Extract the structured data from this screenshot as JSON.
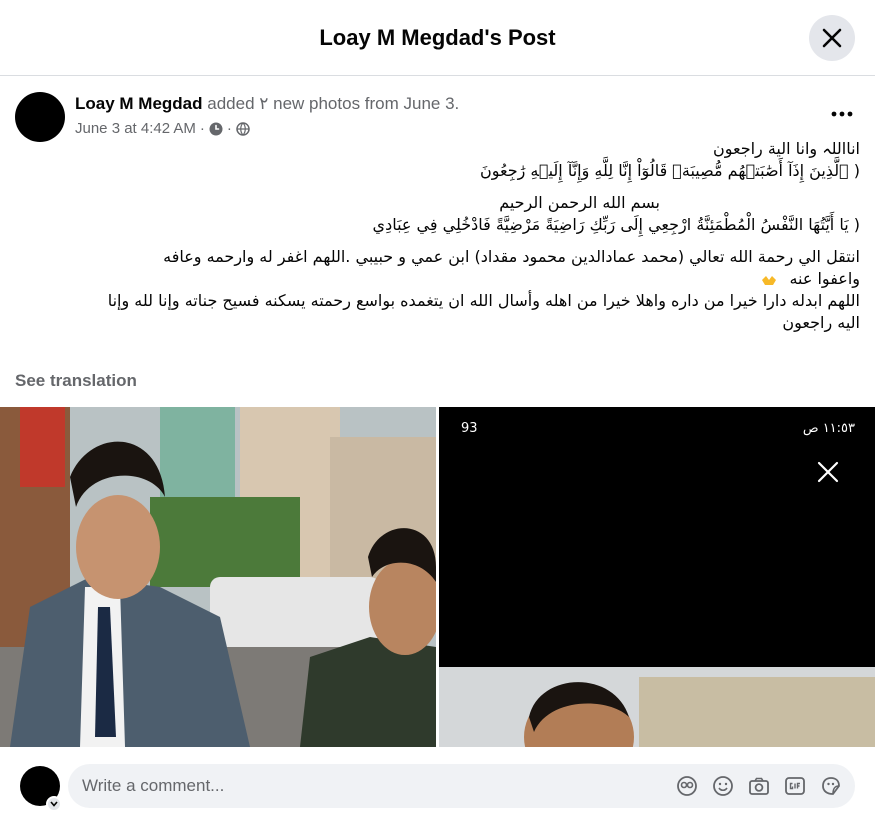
{
  "dialog": {
    "title": "Loay M Megdad's Post"
  },
  "post": {
    "author": "Loay M Megdad",
    "action": "added ٢ new photos from June 3.",
    "timestamp": "June 3 at 4:42 AM",
    "separator": "·",
    "text": {
      "p1_l1": "انااللہ وانا الية راجعون",
      "p1_l2": "( ٱلَّذِينَ إِذَآ أَصَٰبَتۡهُم مُّصِيبَةٞ قَالُوٓاْ إِنَّا لِلَّهِ وَإِنَّآ إِلَيۡهِ رَٰجِعُونَ",
      "p2_l1": "بسم الله الرحمن الرحيم",
      "p2_l2": "( يَا أَيَّتُهَا النَّفْسُ الْمُطْمَئِنَّةُ ارْجِعِي إِلَى رَبِّكِ رَاضِيَةً مَرْضِيَّةً فَادْخُلِي فِي عِبَادِي",
      "p3_l1": "انتقل الي  رحمة الله تعالي (محمد عمادالدين محمود مقداد) ابن عمي و حبيبي .اللهم اغفر له وارحمه وعافه",
      "p3_l2": "واعفوا عنه",
      "p3_l3": "اللهم ابدله دارا خيرا من داره واهلا خيرا من اهله وأسال الله ان يتغمده بواسع رحمته يسكنه فسيح جناته وإنا لله وإنا",
      "p3_l4": "اليه راجعون"
    },
    "see_translation": "See translation"
  },
  "photo_right": {
    "time": "١١:٥٣ ص",
    "battery": "93"
  },
  "comment": {
    "placeholder": "Write a comment..."
  },
  "icons": {
    "close": "close-icon",
    "more": "more-icon",
    "clock": "clock-icon",
    "globe": "globe-icon",
    "avatar_toggle": "chevron-down-icon",
    "avatar": "avatar-icon",
    "gif": "gif-icon",
    "emoji": "emoji-icon",
    "camera": "camera-icon",
    "sticker": "sticker-icon"
  },
  "colors": {
    "accent": "#1877f2",
    "secondary_text": "#65676b",
    "input_bg": "#f0f2f5"
  }
}
